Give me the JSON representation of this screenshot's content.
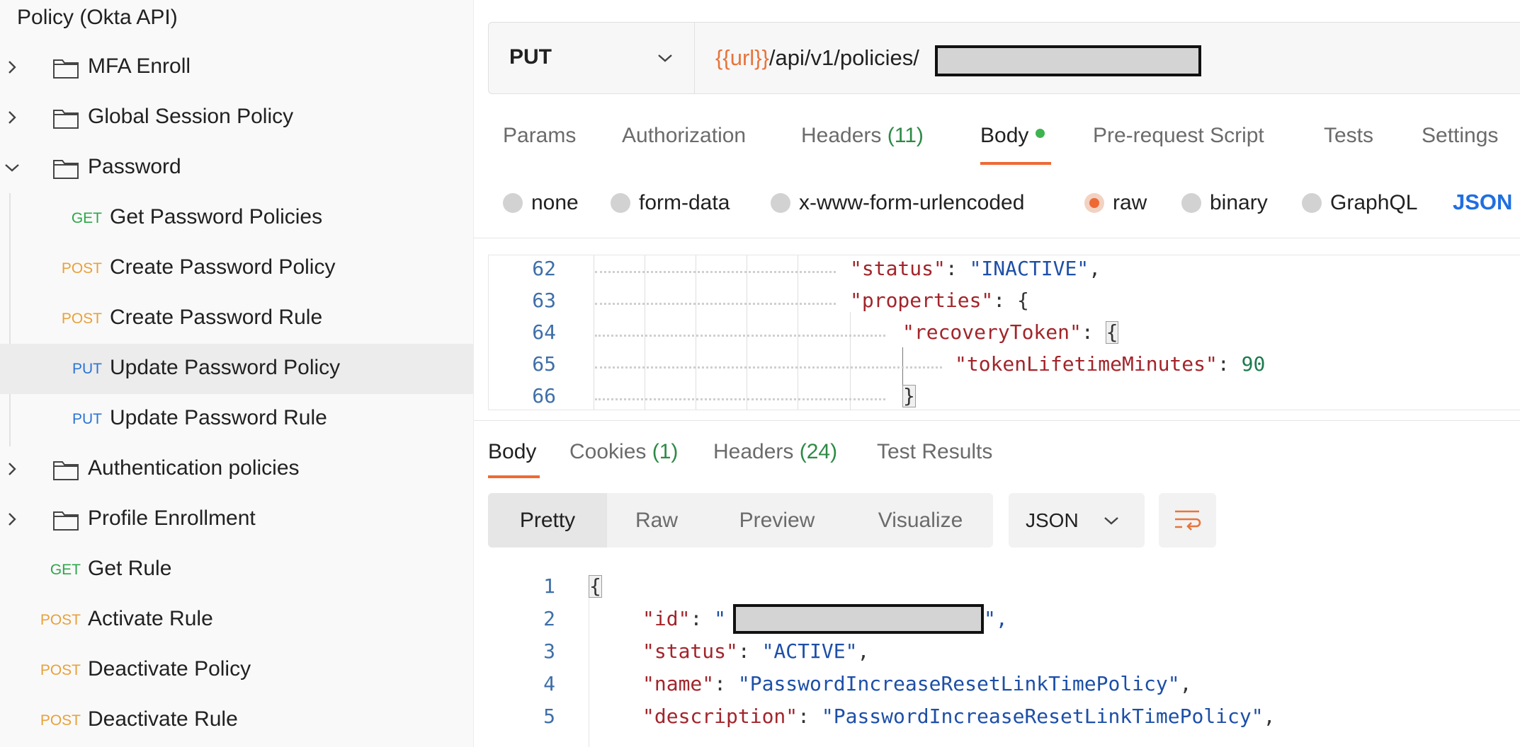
{
  "sidebar": {
    "collection_title": "Policy (Okta API)",
    "items": [
      {
        "type": "folder",
        "label": "MFA Enroll",
        "expanded": false
      },
      {
        "type": "folder",
        "label": "Global Session Policy",
        "expanded": false
      },
      {
        "type": "folder",
        "label": "Password",
        "expanded": true
      },
      {
        "type": "request",
        "method": "GET",
        "label": "Get Password Policies"
      },
      {
        "type": "request",
        "method": "POST",
        "label": "Create Password Policy"
      },
      {
        "type": "request",
        "method": "POST",
        "label": "Create Password Rule"
      },
      {
        "type": "request",
        "method": "PUT",
        "label": "Update Password Policy",
        "selected": true
      },
      {
        "type": "request",
        "method": "PUT",
        "label": "Update Password Rule"
      },
      {
        "type": "folder",
        "label": "Authentication policies",
        "expanded": false
      },
      {
        "type": "folder",
        "label": "Profile Enrollment",
        "expanded": false
      },
      {
        "type": "request",
        "method": "GET",
        "label": "Get Rule"
      },
      {
        "type": "request",
        "method": "POST",
        "label": "Activate Rule"
      },
      {
        "type": "request",
        "method": "POST",
        "label": "Deactivate Policy"
      },
      {
        "type": "request",
        "method": "POST",
        "label": "Deactivate Rule"
      }
    ]
  },
  "request": {
    "method": "PUT",
    "url_variable": "{{url}}",
    "url_path": "/api/v1/policies/",
    "tabs": [
      {
        "label": "Params"
      },
      {
        "label": "Authorization"
      },
      {
        "label": "Headers",
        "count": "(11)"
      },
      {
        "label": "Body",
        "active": true,
        "indicator": "green-dot"
      },
      {
        "label": "Pre-request Script"
      },
      {
        "label": "Tests"
      },
      {
        "label": "Settings"
      }
    ],
    "body_types": [
      {
        "label": "none"
      },
      {
        "label": "form-data"
      },
      {
        "label": "x-www-form-urlencoded"
      },
      {
        "label": "raw",
        "selected": true
      },
      {
        "label": "binary"
      },
      {
        "label": "GraphQL"
      }
    ],
    "body_format": "JSON",
    "editor_lines": [
      {
        "n": "62",
        "key": "\"status\"",
        "sep": ": ",
        "val": "\"INACTIVE\"",
        "end": ","
      },
      {
        "n": "63",
        "key": "\"properties\"",
        "sep": ": ",
        "val": "{",
        "end": ""
      },
      {
        "n": "64",
        "key": "\"recoveryToken\"",
        "sep": ": ",
        "val": "{",
        "end": ""
      },
      {
        "n": "65",
        "key": "\"tokenLifetimeMinutes\"",
        "sep": ": ",
        "val": "90",
        "end": ""
      },
      {
        "n": "66",
        "key": "",
        "sep": "",
        "val": "}",
        "end": ""
      }
    ]
  },
  "response": {
    "tabs": [
      {
        "label": "Body",
        "active": true
      },
      {
        "label": "Cookies",
        "count": "(1)"
      },
      {
        "label": "Headers",
        "count": "(24)"
      },
      {
        "label": "Test Results"
      }
    ],
    "view_modes": [
      "Pretty",
      "Raw",
      "Preview",
      "Visualize"
    ],
    "active_view": "Pretty",
    "format": "JSON",
    "editor_lines": [
      {
        "n": "1",
        "key": "",
        "sep": "",
        "val": "{",
        "end": ""
      },
      {
        "n": "2",
        "key": "\"id\"",
        "sep": ": ",
        "val": "\"",
        "end": "\","
      },
      {
        "n": "3",
        "key": "\"status\"",
        "sep": ": ",
        "val": "\"ACTIVE\"",
        "end": ","
      },
      {
        "n": "4",
        "key": "\"name\"",
        "sep": ": ",
        "val": "\"PasswordIncreaseResetLinkTimePolicy\"",
        "end": ","
      },
      {
        "n": "5",
        "key": "\"description\"",
        "sep": ": ",
        "val": "\"PasswordIncreaseResetLinkTimePolicy\"",
        "end": ","
      }
    ]
  },
  "colors": {
    "accent": "#ee6a35",
    "get": "#2ea64a",
    "post": "#e8a13a",
    "put": "#2b74d4",
    "json_link": "#1f6fe0"
  }
}
